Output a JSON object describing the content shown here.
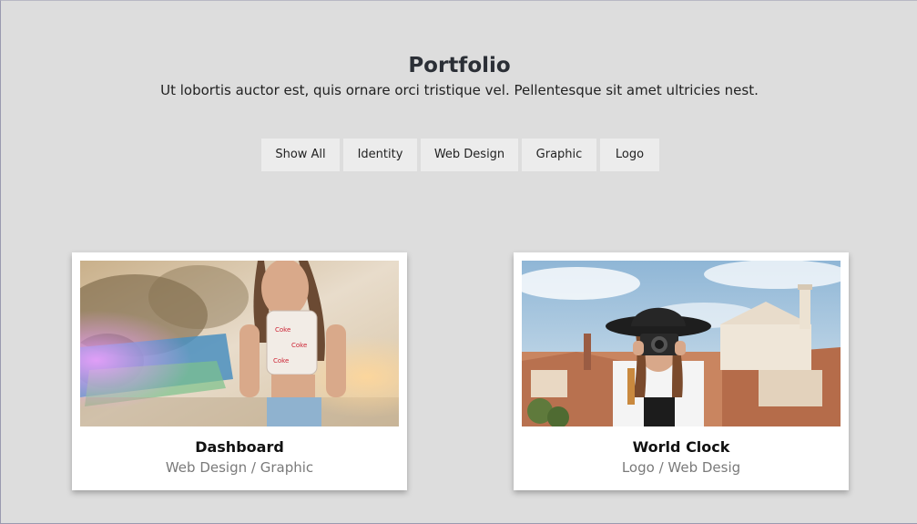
{
  "header": {
    "title": "Portfolio",
    "subtitle": "Ut lobortis auctor est, quis ornare orci tristique vel. Pellentesque sit amet ultricies nest."
  },
  "filters": [
    {
      "label": "Show All"
    },
    {
      "label": "Identity"
    },
    {
      "label": "Web Design"
    },
    {
      "label": "Graphic"
    },
    {
      "label": "Logo"
    }
  ],
  "portfolio": [
    {
      "title": "Dashboard",
      "categories": "Web Design / Graphic",
      "image_icon": "woman-in-crop-top-photo"
    },
    {
      "title": "World Clock",
      "categories": "Logo / Web Desig",
      "image_icon": "woman-with-camera-photo"
    }
  ],
  "colors": {
    "page_background": "#dddddd",
    "filter_background": "#ececec",
    "card_background": "#ffffff",
    "category_text": "#7a7a7a"
  }
}
